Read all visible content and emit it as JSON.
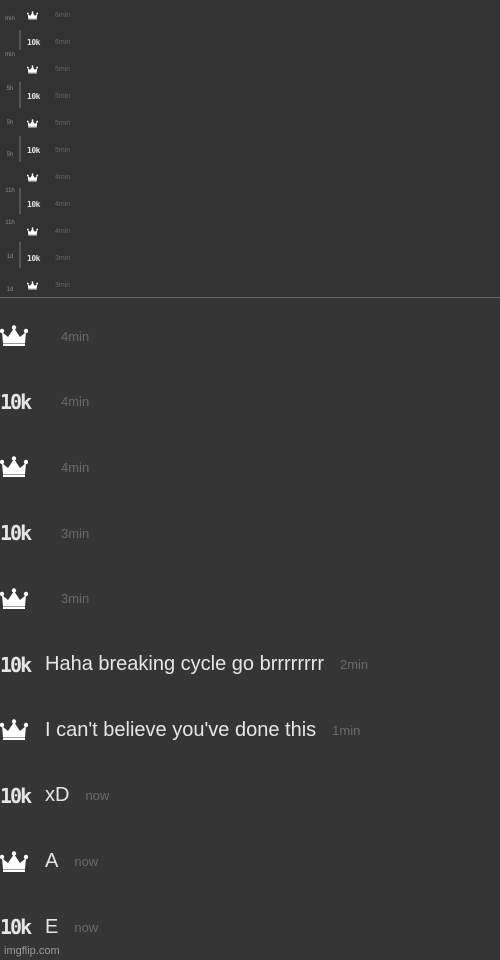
{
  "inset": {
    "left_ticks": [
      "min",
      "min",
      "5h",
      "5h",
      "5h",
      "11h",
      "11h",
      "1d",
      "1d"
    ],
    "rows": [
      {
        "avatar": "crown",
        "time": "6min"
      },
      {
        "avatar": "10k",
        "time": "6min"
      },
      {
        "avatar": "crown",
        "time": "5min"
      },
      {
        "avatar": "10k",
        "time": "5min"
      },
      {
        "avatar": "crown",
        "time": "5min"
      },
      {
        "avatar": "10k",
        "time": "5min"
      },
      {
        "avatar": "crown",
        "time": "4min"
      },
      {
        "avatar": "10k",
        "time": "4min"
      },
      {
        "avatar": "crown",
        "time": "4min"
      },
      {
        "avatar": "10k",
        "time": "3min"
      },
      {
        "avatar": "crown",
        "time": "3min"
      }
    ],
    "avatar_10k_label": "10k"
  },
  "messages": [
    {
      "avatar": "crown",
      "text": "",
      "time": "4min"
    },
    {
      "avatar": "10k",
      "text": "",
      "time": "4min"
    },
    {
      "avatar": "crown",
      "text": "",
      "time": "4min"
    },
    {
      "avatar": "10k",
      "text": "",
      "time": "3min"
    },
    {
      "avatar": "crown",
      "text": "",
      "time": "3min"
    },
    {
      "avatar": "10k",
      "text": "Haha breaking cycle go brrrrrrrr",
      "time": "2min"
    },
    {
      "avatar": "crown",
      "text": "I can't believe you've done this",
      "time": "1min"
    },
    {
      "avatar": "10k",
      "text": "xD",
      "time": "now"
    },
    {
      "avatar": "crown",
      "text": "A",
      "time": "now"
    },
    {
      "avatar": "10k",
      "text": "E",
      "time": "now"
    }
  ],
  "avatar_10k_label": "10k",
  "watermark": "imgflip.com",
  "colors": {
    "background": "#353535",
    "text": "#e6e6e6",
    "timestamp": "#6a6a6a"
  }
}
